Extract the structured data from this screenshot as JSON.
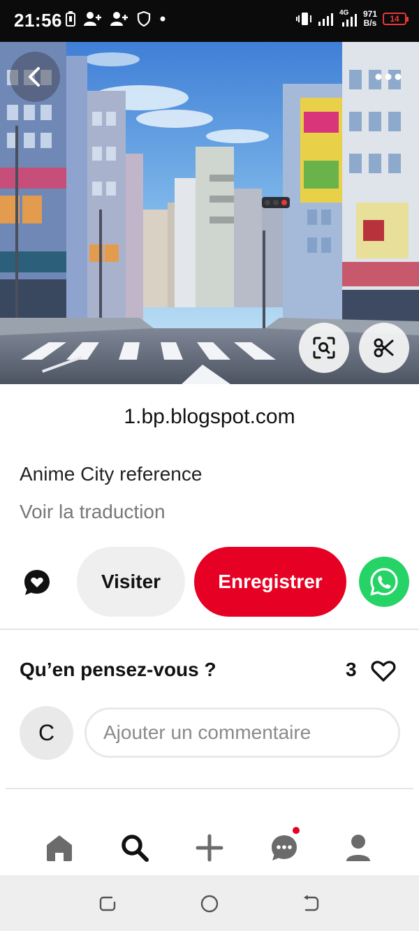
{
  "status_bar": {
    "time": "21:56",
    "network_speed_value": "971",
    "network_speed_unit": "B/s",
    "network_type": "4G",
    "battery": "14"
  },
  "pin": {
    "source_domain": "1.bp.blogspot.com",
    "description": "Anime City reference",
    "translate_label": "Voir la traduction"
  },
  "actions": {
    "visit_label": "Visiter",
    "save_label": "Enregistrer"
  },
  "comments": {
    "title": "Qu’en pensez-vous ?",
    "like_count": "3",
    "avatar_initial": "C",
    "input_placeholder": "Ajouter un commentaire"
  },
  "bottom_nav": {
    "items": [
      "home-icon",
      "search-icon",
      "plus-icon",
      "chat-icon",
      "profile-icon"
    ],
    "active": "search-icon"
  },
  "colors": {
    "brand_red": "#e60023",
    "whatsapp_green": "#25d366",
    "status_bar_bg": "#0b0b0b",
    "battery_low": "#e53935"
  }
}
